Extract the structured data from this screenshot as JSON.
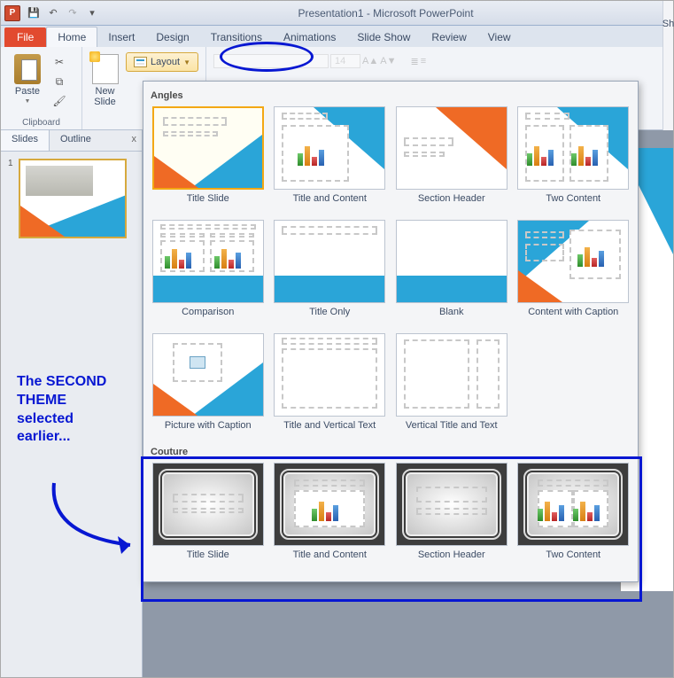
{
  "titlebar": {
    "title": "Presentation1 - Microsoft PowerPoint",
    "app_icon": "P"
  },
  "tabs": {
    "file": "File",
    "home": "Home",
    "insert": "Insert",
    "design": "Design",
    "transitions": "Transitions",
    "animations": "Animations",
    "slideshow": "Slide Show",
    "review": "Review",
    "view": "View"
  },
  "ribbon": {
    "clipboard": {
      "label": "Clipboard",
      "paste": "Paste"
    },
    "slides": {
      "newslide": "New\nSlide",
      "layout": "Layout"
    },
    "font_size": "14",
    "right_sh": "Sh"
  },
  "left": {
    "slides_tab": "Slides",
    "outline_tab": "Outline",
    "close": "x",
    "num1": "1"
  },
  "gallery": {
    "section1": "Angles",
    "section2": "Couture",
    "angles": [
      "Title Slide",
      "Title and Content",
      "Section Header",
      "Two Content",
      "Comparison",
      "Title Only",
      "Blank",
      "Content with Caption",
      "Picture with Caption",
      "Title and Vertical Text",
      "Vertical Title and Text"
    ],
    "couture": [
      "Title Slide",
      "Title and Content",
      "Section Header",
      "Two Content"
    ]
  },
  "annotation": "The SECOND THEME selected earlier..."
}
